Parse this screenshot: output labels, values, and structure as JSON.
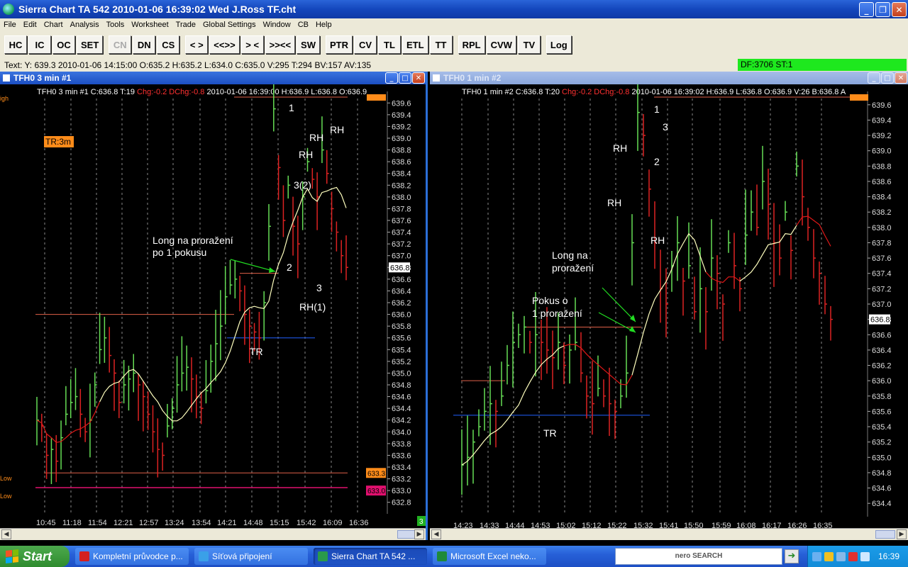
{
  "window": {
    "title": "Sierra Chart TA 542  2010-01-06  16:39:02  Wed   J.Ross TF.cht"
  },
  "menu": [
    "File",
    "Edit",
    "Chart",
    "Analysis",
    "Tools",
    "Worksheet",
    "Trade",
    "Global Settings",
    "Window",
    "CB",
    "Help"
  ],
  "toolbar": [
    {
      "label": "HC"
    },
    {
      "label": "IC"
    },
    {
      "label": "OC"
    },
    {
      "label": "SET"
    },
    {
      "label": "CN",
      "disabled": true
    },
    {
      "label": "DN"
    },
    {
      "label": "CS"
    },
    {
      "label": "< >"
    },
    {
      "label": "<<>>"
    },
    {
      "label": "> <"
    },
    {
      "label": ">><<"
    },
    {
      "label": "SW"
    },
    {
      "label": "PTR"
    },
    {
      "label": "CV"
    },
    {
      "label": "TL"
    },
    {
      "label": "ETL"
    },
    {
      "label": "TT"
    },
    {
      "label": "RPL"
    },
    {
      "label": "CVW"
    },
    {
      "label": "TV"
    },
    {
      "label": "Log"
    }
  ],
  "infobar": {
    "text": "Text: Y: 639.3  2010-01-06  14:15:00  O:635.2  H:635.2  L:634.0  C:635.0  V:295  T:294  BV:157  AV:135",
    "status": "DF:3706   ST:1"
  },
  "charts": [
    {
      "window_title": "TFH0  3 min  #1",
      "header": [
        {
          "text": "TFH0  3 min  #1  C:636.8  T:19",
          "color": "#ffffff"
        },
        {
          "text": "Chg:-0.2  DChg:-0.8",
          "color": "#ff3030"
        },
        {
          "text": "2010-01-06  16:39:00  H:636.9  L:636.8  O:636.9",
          "color": "#ffffff"
        }
      ],
      "price_labels": [
        "639.6",
        "639.4",
        "639.2",
        "639.0",
        "638.8",
        "638.6",
        "638.4",
        "638.2",
        "638.0",
        "637.8",
        "637.6",
        "637.4",
        "637.2",
        "637.0",
        "636.8",
        "636.6",
        "636.4",
        "636.2",
        "636.0",
        "635.8",
        "635.6",
        "635.4",
        "635.2",
        "635.0",
        "634.8",
        "634.6",
        "634.4",
        "634.2",
        "634.0",
        "633.8",
        "633.6",
        "633.4",
        "633.2",
        "633.0",
        "632.8"
      ],
      "current_price": "636.8",
      "price_range": [
        632.7,
        639.7
      ],
      "time_labels": [
        "10:45",
        "11:18",
        "11:54",
        "12:21",
        "12:57",
        "13:24",
        "13:54",
        "14:21",
        "14:48",
        "15:15",
        "15:42",
        "16:09",
        "16:36"
      ],
      "left_labels": [
        "igh",
        "Low",
        "Low"
      ],
      "right_tags": [
        {
          "text": "633.3",
          "color": "#ff8c1a"
        },
        {
          "text": "633.0",
          "color": "#e0106e"
        }
      ],
      "tr_badge": "TR:3m",
      "scroll_badge": "3",
      "annotations": [
        {
          "text": "1"
        },
        {
          "text": "RH"
        },
        {
          "text": "RH"
        },
        {
          "text": "RH"
        },
        {
          "text": "3(2)"
        },
        {
          "text": "Long na proražení"
        },
        {
          "text": "po 1 pokusu"
        },
        {
          "text": "2"
        },
        {
          "text": "3"
        },
        {
          "text": "RH(1)"
        },
        {
          "text": "TR"
        }
      ]
    },
    {
      "window_title": "TFH0  1 min   #2",
      "header": [
        {
          "text": "TFH0  1 min   #2  C:636.8  T:20",
          "color": "#ffffff"
        },
        {
          "text": "Chg:-0.2  DChg:-0.8",
          "color": "#ff3030"
        },
        {
          "text": "2010-01-06  16:39:02  H:636.9  L:636.8  O:636.9  V:26  B:636.8  A",
          "color": "#ffffff"
        }
      ],
      "price_labels": [
        "639.6",
        "639.4",
        "639.2",
        "639.0",
        "638.8",
        "638.6",
        "638.4",
        "638.2",
        "638.0",
        "637.8",
        "637.6",
        "637.4",
        "637.2",
        "637.0",
        "636.8",
        "636.6",
        "636.4",
        "636.2",
        "636.0",
        "635.8",
        "635.6",
        "635.4",
        "635.2",
        "635.0",
        "634.8",
        "634.6",
        "634.4"
      ],
      "current_price": "636.8",
      "price_range": [
        634.3,
        639.7
      ],
      "time_labels": [
        "14:23",
        "14:33",
        "14:44",
        "14:53",
        "15:02",
        "15:12",
        "15:22",
        "15:32",
        "15:41",
        "15:50",
        "15:59",
        "16:08",
        "16:17",
        "16:26",
        "16:35"
      ],
      "scroll_badge": "",
      "annotations": [
        {
          "text": "1"
        },
        {
          "text": "3"
        },
        {
          "text": "RH"
        },
        {
          "text": "2"
        },
        {
          "text": "RH"
        },
        {
          "text": "RH"
        },
        {
          "text": "Long na"
        },
        {
          "text": "proražení"
        },
        {
          "text": "Pokus o"
        },
        {
          "text": "1 proražení"
        },
        {
          "text": "TR"
        }
      ]
    }
  ],
  "taskbar": {
    "start": "Start",
    "tasks": [
      {
        "label": "Kompletní průvodce p...",
        "icon_color": "#d42020"
      },
      {
        "label": "Síťová připojení",
        "icon_color": "#3aa0e8"
      },
      {
        "label": "Sierra Chart TA 542 ...",
        "icon_color": "#2a9a4a",
        "active": true
      },
      {
        "label": "Microsoft Excel neko...",
        "icon_color": "#1e8a3a"
      }
    ],
    "search_logo": "nero SEARCH",
    "clock": "16:39"
  },
  "colors": {
    "ma_up": "#ffffbe",
    "ma_down": "#e01818",
    "bar_up": "#66dd55",
    "bar_down": "#dd2222",
    "support_line": "#2060ff",
    "resistance_line": "#e06048",
    "low_line": "#e0106e"
  }
}
